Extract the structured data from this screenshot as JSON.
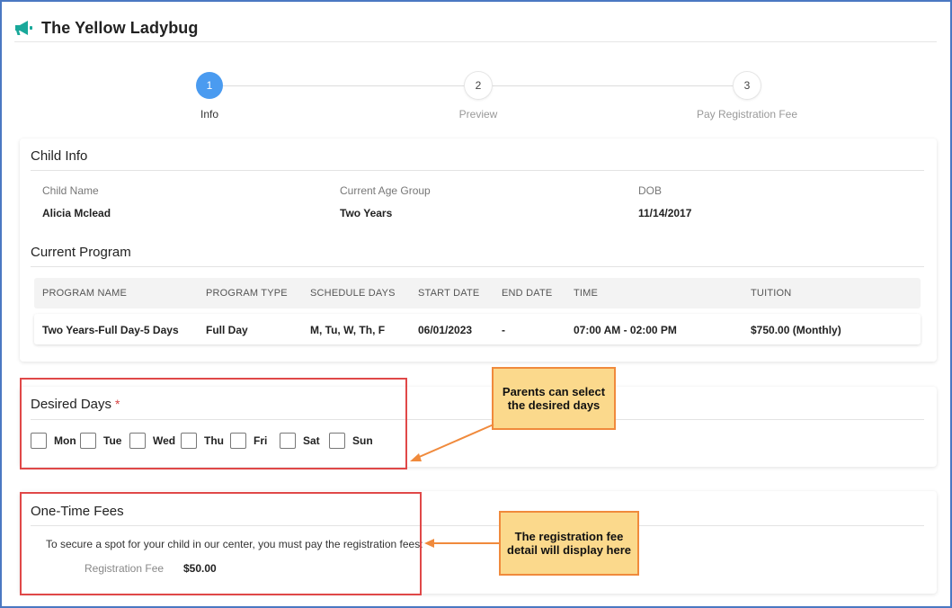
{
  "app": {
    "title": "The Yellow Ladybug",
    "icon": "megaphone-icon",
    "accent": "#19a89a"
  },
  "stepper": {
    "steps": [
      {
        "number": "1",
        "label": "Info",
        "active": true
      },
      {
        "number": "2",
        "label": "Preview",
        "active": false
      },
      {
        "number": "3",
        "label": "Pay Registration Fee",
        "active": false
      }
    ],
    "active_color": "#4a9bf0"
  },
  "child_info": {
    "title": "Child Info",
    "fields": [
      {
        "label": "Child Name",
        "value": "Alicia Mclead"
      },
      {
        "label": "Current Age Group",
        "value": "Two Years"
      },
      {
        "label": "DOB",
        "value": "11/14/2017"
      }
    ]
  },
  "current_program": {
    "title": "Current Program",
    "columns": [
      "PROGRAM NAME",
      "PROGRAM TYPE",
      "SCHEDULE DAYS",
      "START DATE",
      "END DATE",
      "TIME",
      "TUITION"
    ],
    "rows": [
      [
        "Two Years-Full Day-5 Days",
        "Full Day",
        "M, Tu, W, Th, F",
        "06/01/2023",
        "-",
        "07:00 AM - 02:00 PM",
        "$750.00 (Monthly)"
      ]
    ]
  },
  "desired_days": {
    "title": "Desired Days",
    "required_mark": "*",
    "days": [
      "Mon",
      "Tue",
      "Wed",
      "Thu",
      "Fri",
      "Sat",
      "Sun"
    ]
  },
  "one_time_fees": {
    "title": "One-Time Fees",
    "description": "To secure a spot for your child in our center, you must pay the registration fees:",
    "fee_label": "Registration Fee",
    "fee_value": "$50.00"
  },
  "annotations": {
    "days_callout": "Parents can select the desired days",
    "fees_callout": "The registration fee detail will display here",
    "highlight_color": "#e04848",
    "callout_fill": "#fbd98c",
    "callout_border": "#f08a3c"
  }
}
